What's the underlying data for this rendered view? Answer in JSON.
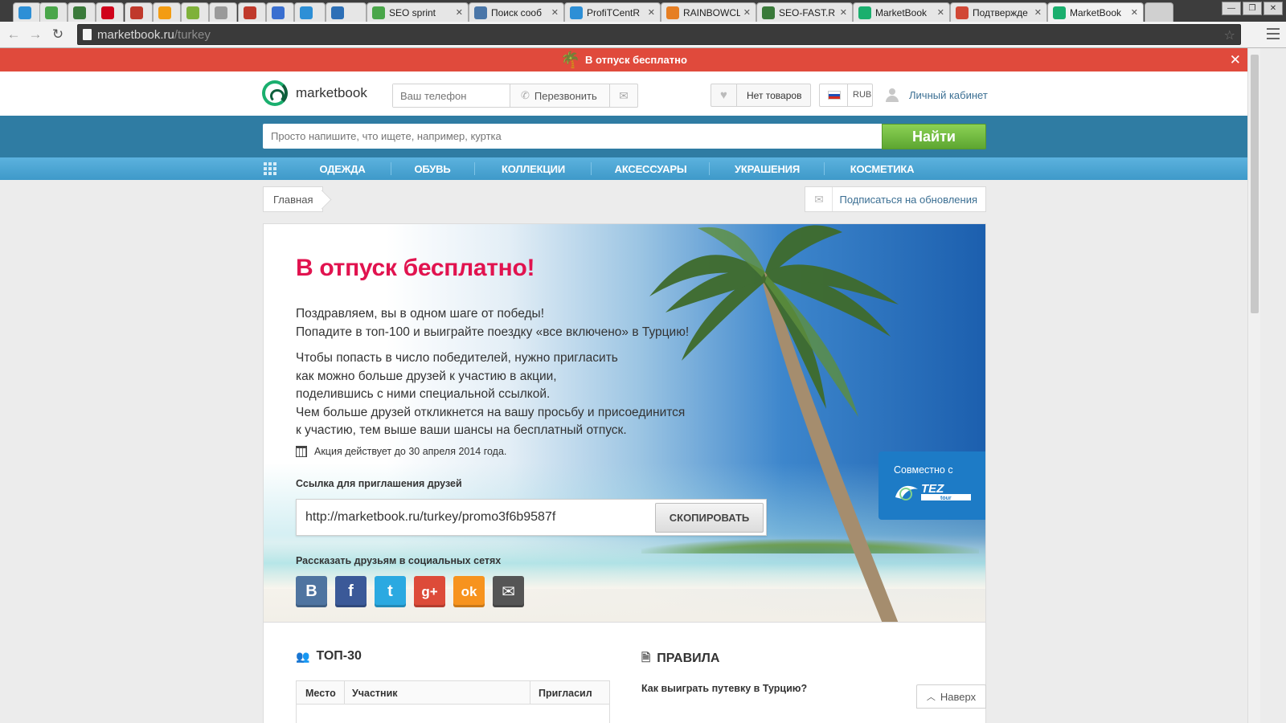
{
  "browser": {
    "tabs": [
      {
        "title": "",
        "favicon": "bar-chart-icon",
        "color": "#2d8fd6"
      },
      {
        "title": "",
        "favicon": "dollar-s-icon",
        "color": "#4aa64a"
      },
      {
        "title": "",
        "favicon": "sf-icon",
        "color": "#3a7a3a"
      },
      {
        "title": "",
        "favicon": "r-icon",
        "color": "#d0021b"
      },
      {
        "title": "",
        "favicon": "emblem-icon",
        "color": "#c0392b"
      },
      {
        "title": "",
        "favicon": "at-icon",
        "color": "#f39c12"
      },
      {
        "title": "",
        "favicon": "coin-icon",
        "color": "#7fb13a"
      },
      {
        "title": "",
        "favicon": "g-icon",
        "color": "#9a9a9a"
      },
      {
        "title": "",
        "favicon": "people-icon",
        "color": "#c0392b"
      },
      {
        "title": "",
        "favicon": "vip-icon",
        "color": "#3a6fd0"
      },
      {
        "title": "",
        "favicon": "heart-icon",
        "color": "#2d8fd6"
      },
      {
        "title": "",
        "favicon": "globe-icon",
        "color": "#2d6fb6"
      },
      {
        "title": "SEO sprint",
        "favicon": "dollar-s-icon",
        "color": "#4aa64a"
      },
      {
        "title": "Поиск сооб",
        "favicon": "vk-icon",
        "color": "#4a76a8"
      },
      {
        "title": "ProfiTCentR",
        "favicon": "bar-chart-icon",
        "color": "#2d8fd6"
      },
      {
        "title": "RAINBOWCL",
        "favicon": "rainbow-icon",
        "color": "#e67e22"
      },
      {
        "title": "SEO-FAST.R",
        "favicon": "sf-icon",
        "color": "#3a7a3a"
      },
      {
        "title": "MarketBook",
        "favicon": "marketbook-icon",
        "color": "#1aaf6e"
      },
      {
        "title": "Подтвержде",
        "favicon": "gmail-icon",
        "color": "#d14836"
      },
      {
        "title": "MarketBook",
        "favicon": "marketbook-icon",
        "color": "#1aaf6e"
      }
    ],
    "url_host": "marketbook.ru",
    "url_path": "/turkey"
  },
  "promo_bar": {
    "text": "В отпуск бесплатно",
    "close": "✕"
  },
  "header": {
    "logo": "marketbook",
    "phone_placeholder": "Ваш телефон",
    "callback_label": "Перезвонить",
    "cart_label": "Нет товаров",
    "currency": "RUB",
    "account_label": "Личный кабинет"
  },
  "search": {
    "placeholder": "Просто напишите, что ищете, например, куртка",
    "button": "Найти"
  },
  "categories": [
    "ОДЕЖДА",
    "ОБУВЬ",
    "КОЛЛЕКЦИИ",
    "АКСЕССУАРЫ",
    "УКРАШЕНИЯ",
    "КОСМЕТИКА"
  ],
  "breadcrumb": {
    "home": "Главная",
    "subscribe": "Подписаться на обновления"
  },
  "hero": {
    "title": "В отпуск бесплатно!",
    "p1": [
      "Поздравляем, вы в одном шаге от победы!",
      "Попадите в топ-100 и выиграйте поездку «все включено» в Турцию!"
    ],
    "p2": [
      "Чтобы попасть в число победителей, нужно пригласить",
      "как можно больше друзей к участию в акции,",
      "поделившись с ними специальной ссылкой.",
      "Чем больше друзей откликнется на вашу просьбу и присоединится",
      "к участию, тем выше ваши шансы на бесплатный отпуск."
    ],
    "deadline": "Акция действует до 30 апреля 2014 года.",
    "link_label": "Ссылка для приглашения друзей",
    "link_value": "http://marketbook.ru/turkey/promo3f6b9587f",
    "copy_button": "СКОПИРОВАТЬ",
    "share_label": "Рассказать друзьям в социальных сетях",
    "socials": [
      {
        "name": "vk-icon",
        "glyph": "B",
        "color": "#4f74a0"
      },
      {
        "name": "facebook-icon",
        "glyph": "f",
        "color": "#3b5998"
      },
      {
        "name": "twitter-icon",
        "glyph": "t",
        "color": "#2ba9e1"
      },
      {
        "name": "google-plus-icon",
        "glyph": "g+",
        "color": "#dd4b39"
      },
      {
        "name": "odnoklassniki-icon",
        "glyph": "ok",
        "color": "#f7931e"
      },
      {
        "name": "email-icon",
        "glyph": "✉",
        "color": "#555555"
      }
    ],
    "partner_caption": "Совместно с",
    "partner_logo": "TEZ tour"
  },
  "top30": {
    "title": "ТОП-30",
    "columns": [
      "Место",
      "Участник",
      "Пригласил"
    ]
  },
  "rules": {
    "title": "ПРАВИЛА",
    "question": "Как выиграть путевку в Турцию?"
  },
  "to_top": "Наверх"
}
